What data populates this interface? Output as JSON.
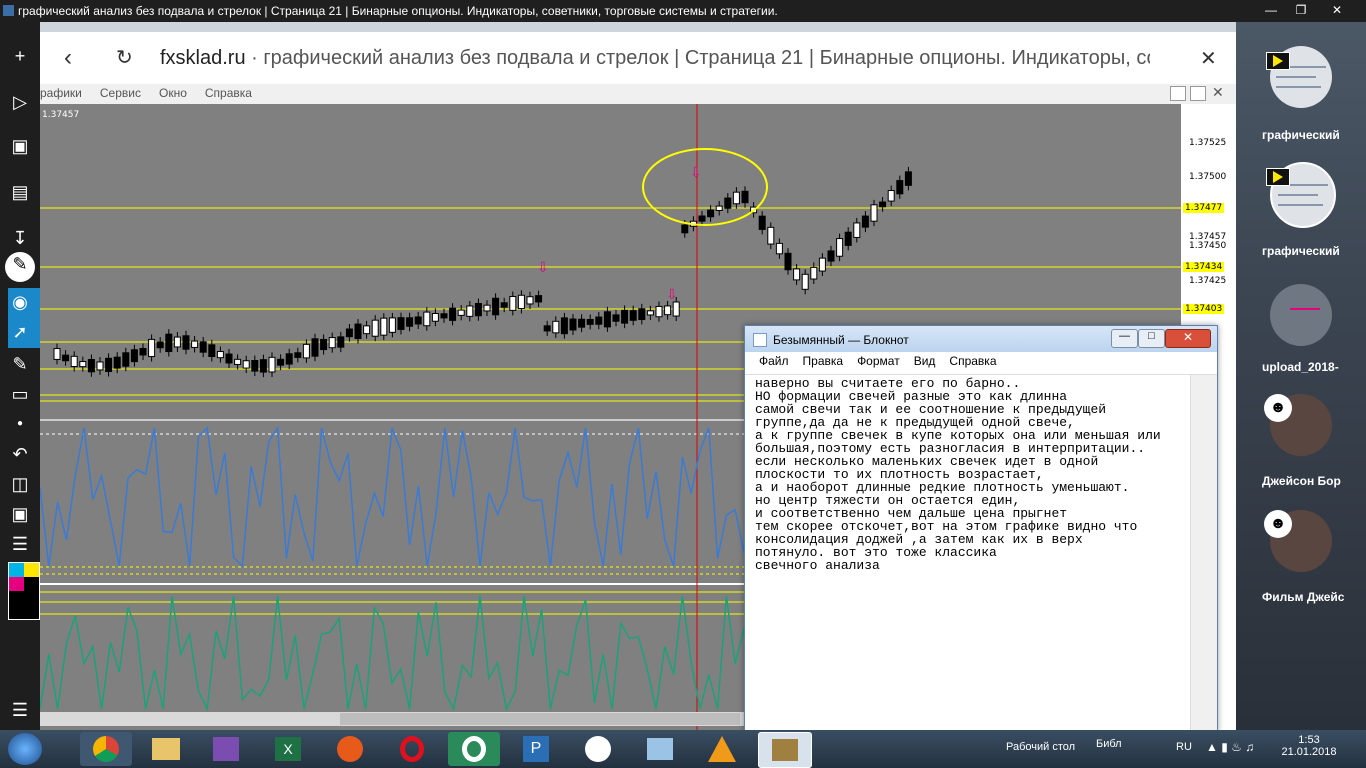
{
  "window_title": "графический анализ без подвала и стрелок | Страница 21 | Бинарные опционы. Индикаторы, советники, торговые системы и стратегии.",
  "browser": {
    "domain": "fxsklad.ru",
    "title_rest": " · графический анализ без подвала и стрелок | Страница 21 | Бинарные опционы. Индикаторы, со"
  },
  "mt4_menu": [
    "рафики",
    "Сервис",
    "Окно",
    "Справка"
  ],
  "price_labels": [
    "1.37457",
    "1.37525",
    "1.37500",
    "1.37477",
    "1.37457",
    "1.37450",
    "1.37434",
    "1.37425",
    "1.37403"
  ],
  "notepad": {
    "title": "Безымянный — Блокнот",
    "menu": [
      "Файл",
      "Правка",
      "Формат",
      "Вид",
      "Справка"
    ],
    "lines": [
      "наверно вы считаете его по барно..",
      "НО формации свечей разные это как длинна",
      "самой свечи так и ее соотношение к предыдущей",
      "группе,да да не к предыдущей одной свече,",
      "а к группе свечек в купе которых она или меньшая или",
      "большая,поэтому есть разногласия в интерпритации..",
      "если несколько маленьких свечек идет в одной",
      "плоскости то их плотность возрастает,",
      "а и наоборот длинные редкие плотность уменьшают.",
      "но центр тяжести он остается един,",
      "и соответственно чем дальше цена прыгнет",
      "тем скорее отскочет,вот на этом графике видно что",
      "консолидация доджей ,а затем как их в верх",
      "потянуло. вот это тоже классика",
      "свечного анализа"
    ]
  },
  "right_panel": {
    "items": [
      "графический",
      "графический",
      "upload_2018-",
      "Джейсон Бор",
      "Фильм Джейс"
    ]
  },
  "taskbar": {
    "desktop_label": "Рабочий стол",
    "extra_label": "Библ",
    "lang": "RU",
    "time": "1:53",
    "date": "21.01.2018"
  }
}
